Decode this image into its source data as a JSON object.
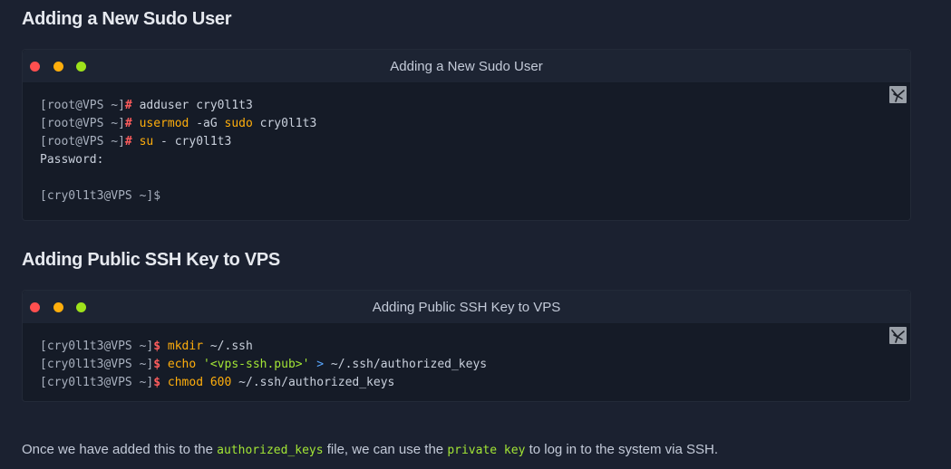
{
  "section1": {
    "heading": "Adding a New Sudo User",
    "window_title": "Adding a New Sudo User",
    "lines": [
      {
        "prompt": "[root@VPS ~]",
        "sigil": "#",
        "parts": [
          {
            "text": " adduser cry0l1t3",
            "cls": ""
          }
        ]
      },
      {
        "prompt": "[root@VPS ~]",
        "sigil": "#",
        "parts": [
          {
            "text": " ",
            "cls": ""
          },
          {
            "text": "usermod",
            "cls": "cmd"
          },
          {
            "text": " -aG ",
            "cls": ""
          },
          {
            "text": "sudo",
            "cls": "cmd"
          },
          {
            "text": " cry0l1t3",
            "cls": ""
          }
        ]
      },
      {
        "prompt": "[root@VPS ~]",
        "sigil": "#",
        "parts": [
          {
            "text": " ",
            "cls": ""
          },
          {
            "text": "su",
            "cls": "cmd"
          },
          {
            "text": " - cry0l1t3",
            "cls": ""
          }
        ]
      },
      {
        "prompt": "",
        "sigil": "",
        "parts": [
          {
            "text": "Password:",
            "cls": ""
          }
        ]
      },
      {
        "prompt": "",
        "sigil": "",
        "parts": [
          {
            "text": "",
            "cls": ""
          }
        ]
      },
      {
        "prompt": "[cry0l1t3@VPS ~]$",
        "sigil": "",
        "parts": []
      }
    ]
  },
  "section2": {
    "heading": "Adding Public SSH Key to VPS",
    "window_title": "Adding Public SSH Key to VPS",
    "lines": [
      {
        "prompt": "[cry0l1t3@VPS ~]",
        "sigil": "$",
        "parts": [
          {
            "text": " ",
            "cls": ""
          },
          {
            "text": "mkdir",
            "cls": "cmd"
          },
          {
            "text": " ~/.ssh",
            "cls": ""
          }
        ]
      },
      {
        "prompt": "[cry0l1t3@VPS ~]",
        "sigil": "$",
        "parts": [
          {
            "text": " ",
            "cls": ""
          },
          {
            "text": "echo",
            "cls": "cmd"
          },
          {
            "text": " ",
            "cls": ""
          },
          {
            "text": "'<vps-ssh.pub>'",
            "cls": "str"
          },
          {
            "text": " ",
            "cls": ""
          },
          {
            "text": ">",
            "cls": "op"
          },
          {
            "text": " ~/.ssh/authorized_keys",
            "cls": ""
          }
        ]
      },
      {
        "prompt": "[cry0l1t3@VPS ~]",
        "sigil": "$",
        "parts": [
          {
            "text": " ",
            "cls": ""
          },
          {
            "text": "chmod",
            "cls": "cmd"
          },
          {
            "text": " ",
            "cls": ""
          },
          {
            "text": "600",
            "cls": "num"
          },
          {
            "text": " ~/.ssh/authorized_keys",
            "cls": ""
          }
        ]
      }
    ]
  },
  "paragraph": {
    "before": "Once we have added this to the ",
    "code1": "authorized_keys",
    "middle": " file, we can use the ",
    "code2": "private key",
    "after": " to log in to the system via SSH."
  },
  "icons": {
    "copy": "copy-icon"
  },
  "colors": {
    "background": "#1b2130",
    "command": "#ffae0c",
    "string": "#a3e635",
    "sigil": "#ff5c5c"
  }
}
